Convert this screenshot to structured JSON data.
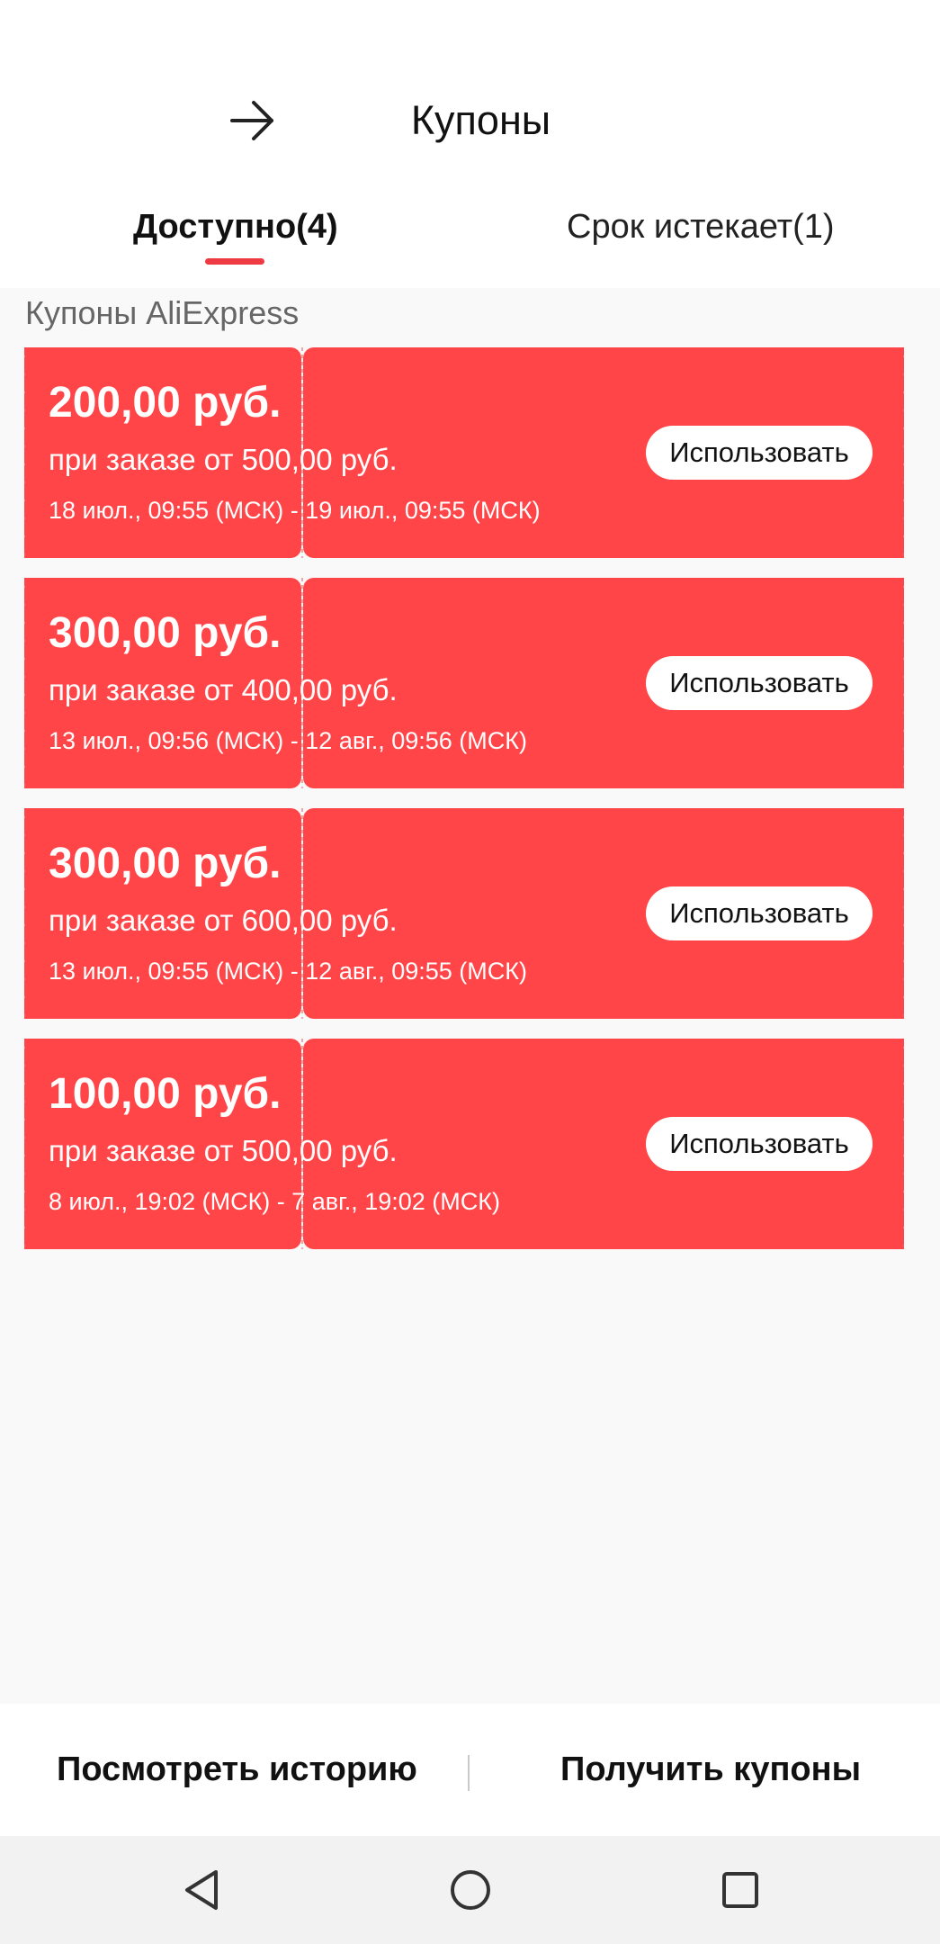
{
  "header": {
    "title": "Купоны",
    "back_icon": "arrow-right-icon"
  },
  "tabs": [
    {
      "label": "Доступно(4)",
      "active": true
    },
    {
      "label": "Срок истекает(1)",
      "active": false
    }
  ],
  "section": {
    "label": "Купоны AliExpress"
  },
  "coupons": [
    {
      "amount": "200,00 руб.",
      "condition": "при заказе от 500,00 руб.",
      "dates": "18 июл., 09:55 (МСК) - 19 июл., 09:55 (МСК)",
      "button": "Использовать"
    },
    {
      "amount": "300,00 руб.",
      "condition": "при заказе от 400,00 руб.",
      "dates": "13 июл., 09:56 (МСК) - 12 авг., 09:56 (МСК)",
      "button": "Использовать"
    },
    {
      "amount": "300,00 руб.",
      "condition": "при заказе от 600,00 руб.",
      "dates": "13 июл., 09:55 (МСК) - 12 авг., 09:55 (МСК)",
      "button": "Использовать"
    },
    {
      "amount": "100,00 руб.",
      "condition": "при заказе от 500,00 руб.",
      "dates": "8 июл., 19:02 (МСК) - 7 авг., 19:02 (МСК)",
      "button": "Использовать"
    }
  ],
  "bottom": {
    "history": "Посмотреть историю",
    "get_coupons": "Получить купоны"
  },
  "navbar": {
    "back_icon": "triangle-back-icon",
    "home_icon": "circle-home-icon",
    "recent_icon": "square-recents-icon"
  },
  "colors": {
    "accent": "#ff4547",
    "tab_underline": "#ee3a43",
    "background": "#f9f9f9"
  }
}
